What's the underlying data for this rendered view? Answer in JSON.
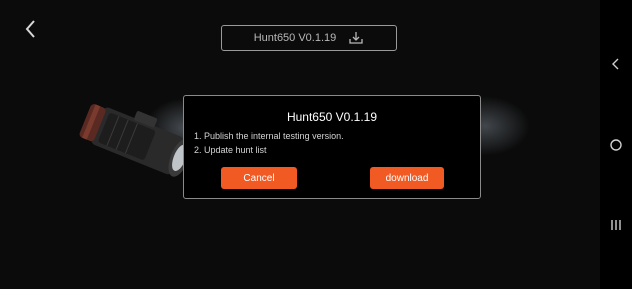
{
  "header": {
    "back_icon": "chevron-left-icon",
    "version_label": "Hunt650  V0.1.19",
    "download_icon": "download-tray-icon"
  },
  "dialog": {
    "title": "Hunt650  V0.1.19",
    "notes": [
      "1. Publish the internal testing version.",
      "2. Update hunt list"
    ],
    "cancel_label": "Cancel",
    "download_label": "download",
    "button_color": "#f15a22"
  },
  "system_nav": {
    "back_icon": "nav-back-icon",
    "home_icon": "nav-home-icon",
    "recents_icon": "nav-recents-icon"
  }
}
